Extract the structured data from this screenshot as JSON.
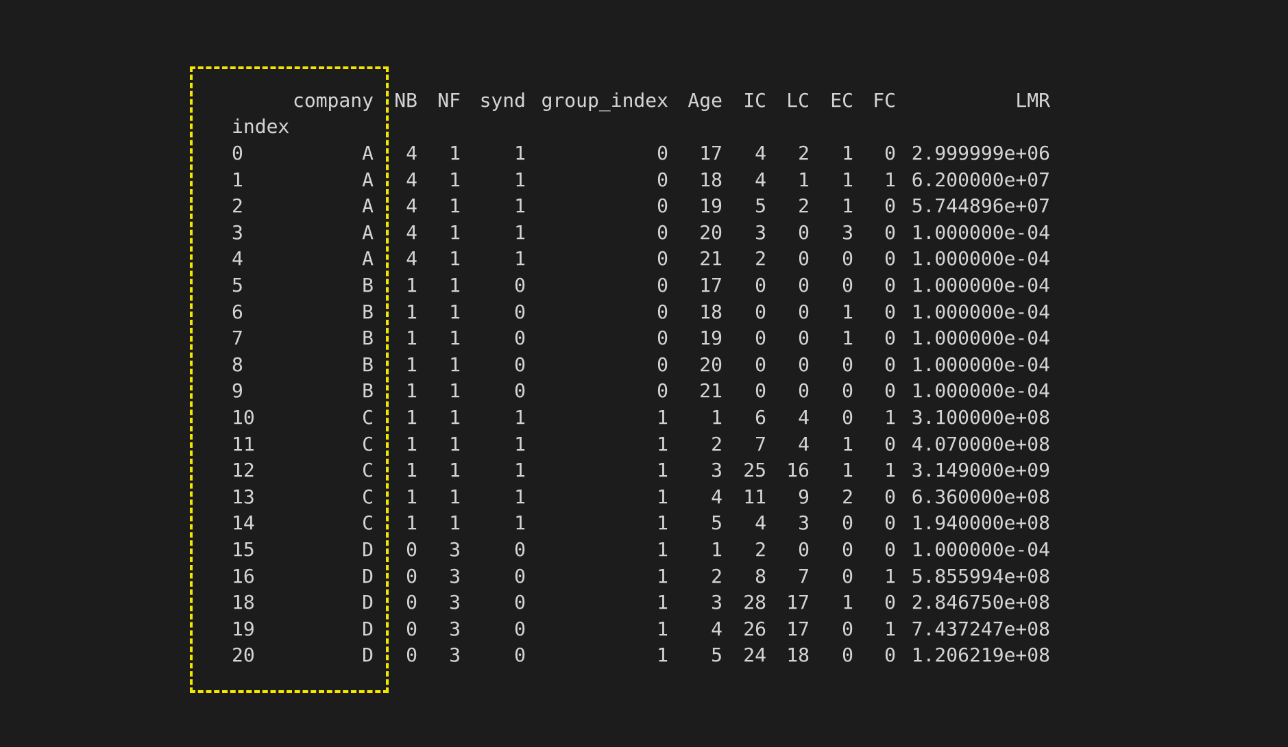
{
  "table": {
    "index_name": "index",
    "columns": [
      "company",
      "NB",
      "NF",
      "synd",
      "group_index",
      "Age",
      "IC",
      "LC",
      "EC",
      "FC",
      "LMR"
    ],
    "rows": [
      {
        "index": "0",
        "values": [
          "A",
          "4",
          "1",
          "1",
          "0",
          "17",
          "4",
          "2",
          "1",
          "0",
          "2.999999e+06"
        ]
      },
      {
        "index": "1",
        "values": [
          "A",
          "4",
          "1",
          "1",
          "0",
          "18",
          "4",
          "1",
          "1",
          "1",
          "6.200000e+07"
        ]
      },
      {
        "index": "2",
        "values": [
          "A",
          "4",
          "1",
          "1",
          "0",
          "19",
          "5",
          "2",
          "1",
          "0",
          "5.744896e+07"
        ]
      },
      {
        "index": "3",
        "values": [
          "A",
          "4",
          "1",
          "1",
          "0",
          "20",
          "3",
          "0",
          "3",
          "0",
          "1.000000e-04"
        ]
      },
      {
        "index": "4",
        "values": [
          "A",
          "4",
          "1",
          "1",
          "0",
          "21",
          "2",
          "0",
          "0",
          "0",
          "1.000000e-04"
        ]
      },
      {
        "index": "5",
        "values": [
          "B",
          "1",
          "1",
          "0",
          "0",
          "17",
          "0",
          "0",
          "0",
          "0",
          "1.000000e-04"
        ]
      },
      {
        "index": "6",
        "values": [
          "B",
          "1",
          "1",
          "0",
          "0",
          "18",
          "0",
          "0",
          "1",
          "0",
          "1.000000e-04"
        ]
      },
      {
        "index": "7",
        "values": [
          "B",
          "1",
          "1",
          "0",
          "0",
          "19",
          "0",
          "0",
          "1",
          "0",
          "1.000000e-04"
        ]
      },
      {
        "index": "8",
        "values": [
          "B",
          "1",
          "1",
          "0",
          "0",
          "20",
          "0",
          "0",
          "0",
          "0",
          "1.000000e-04"
        ]
      },
      {
        "index": "9",
        "values": [
          "B",
          "1",
          "1",
          "0",
          "0",
          "21",
          "0",
          "0",
          "0",
          "0",
          "1.000000e-04"
        ]
      },
      {
        "index": "10",
        "values": [
          "C",
          "1",
          "1",
          "1",
          "1",
          "1",
          "6",
          "4",
          "0",
          "1",
          "3.100000e+08"
        ]
      },
      {
        "index": "11",
        "values": [
          "C",
          "1",
          "1",
          "1",
          "1",
          "2",
          "7",
          "4",
          "1",
          "0",
          "4.070000e+08"
        ]
      },
      {
        "index": "12",
        "values": [
          "C",
          "1",
          "1",
          "1",
          "1",
          "3",
          "25",
          "16",
          "1",
          "1",
          "3.149000e+09"
        ]
      },
      {
        "index": "13",
        "values": [
          "C",
          "1",
          "1",
          "1",
          "1",
          "4",
          "11",
          "9",
          "2",
          "0",
          "6.360000e+08"
        ]
      },
      {
        "index": "14",
        "values": [
          "C",
          "1",
          "1",
          "1",
          "1",
          "5",
          "4",
          "3",
          "0",
          "0",
          "1.940000e+08"
        ]
      },
      {
        "index": "15",
        "values": [
          "D",
          "0",
          "3",
          "0",
          "1",
          "1",
          "2",
          "0",
          "0",
          "0",
          "1.000000e-04"
        ]
      },
      {
        "index": "16",
        "values": [
          "D",
          "0",
          "3",
          "0",
          "1",
          "2",
          "8",
          "7",
          "0",
          "1",
          "5.855994e+08"
        ]
      },
      {
        "index": "18",
        "values": [
          "D",
          "0",
          "3",
          "0",
          "1",
          "3",
          "28",
          "17",
          "1",
          "0",
          "2.846750e+08"
        ]
      },
      {
        "index": "19",
        "values": [
          "D",
          "0",
          "3",
          "0",
          "1",
          "4",
          "26",
          "17",
          "0",
          "1",
          "7.437247e+08"
        ]
      },
      {
        "index": "20",
        "values": [
          "D",
          "0",
          "3",
          "0",
          "1",
          "5",
          "24",
          "18",
          "0",
          "0",
          "1.206219e+08"
        ]
      }
    ]
  },
  "colors": {
    "background": "#1c1c1c",
    "text": "#d4d4d4",
    "highlight_border": "#f2e600"
  }
}
